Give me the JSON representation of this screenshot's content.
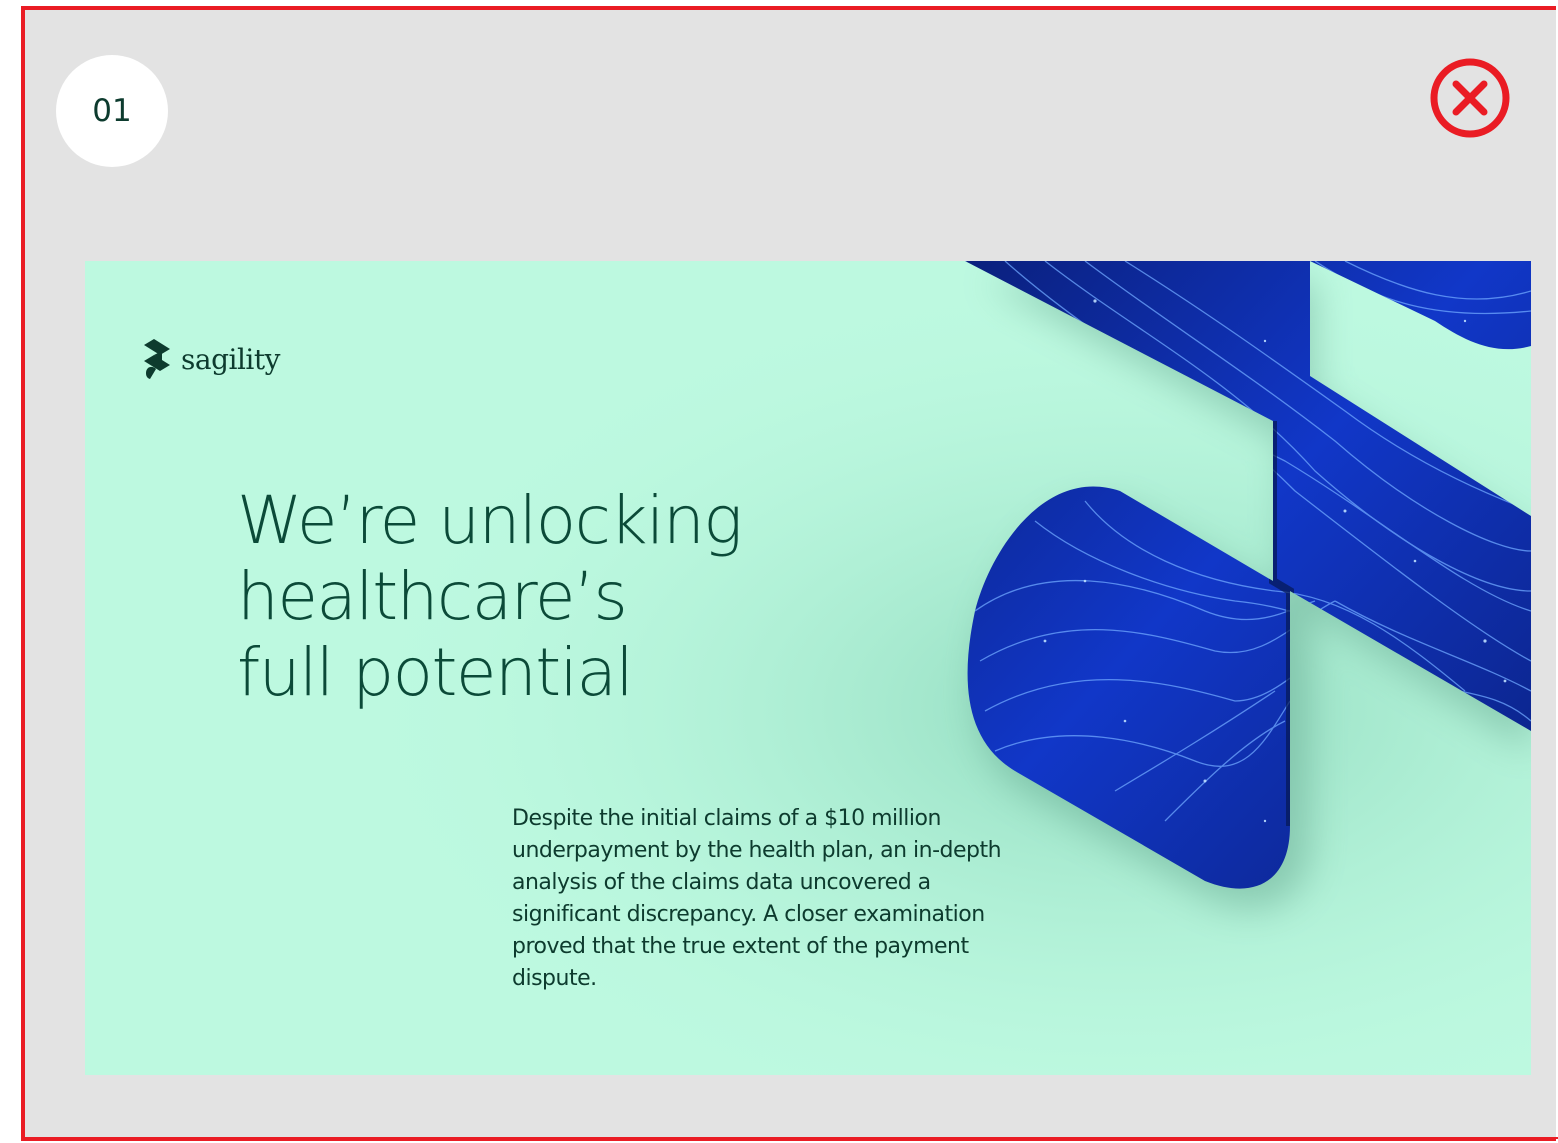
{
  "modal": {
    "step_number": "01",
    "close_icon": "close-circle-icon"
  },
  "colors": {
    "frame_border": "#ea1c24",
    "frame_background": "#e3e3e3",
    "slide_background": "#bdf9e0",
    "brand_dark_green": "#0b4a38",
    "graphic_blue": "#0b2a9e"
  },
  "slide": {
    "logo": {
      "icon": "sagility-logo-icon",
      "wordmark": "sagility"
    },
    "headline": {
      "line1": "We’re unlocking",
      "line2": "healthcare’s",
      "line3": "full potential"
    },
    "body": "Despite the initial claims of a $10 million underpayment by the health plan, an in-depth analysis of the claims data uncovered a significant discrepancy. A closer examination proved that the true extent of the payment dispute.",
    "graphic": "abstract-blue-fiber-s-shape"
  }
}
